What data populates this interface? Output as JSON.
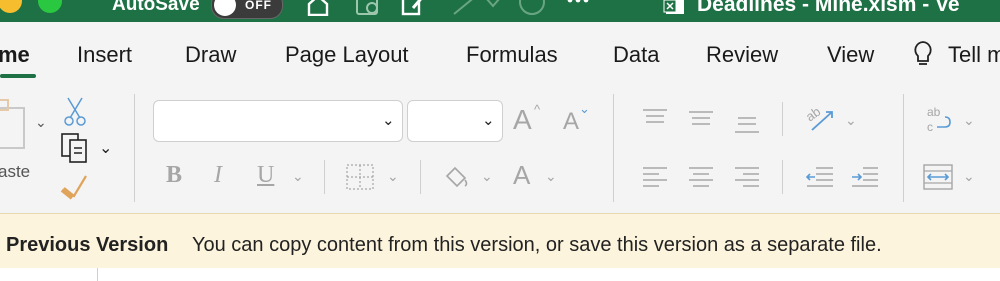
{
  "titlebar": {
    "autosave_label": "AutoSave",
    "toggle_label": "OFF",
    "document_title": "Deadlines - Mine.xlsm - Ve"
  },
  "tabs": [
    {
      "label": "me",
      "active": true
    },
    {
      "label": "Insert"
    },
    {
      "label": "Draw"
    },
    {
      "label": "Page Layout"
    },
    {
      "label": "Formulas"
    },
    {
      "label": "Data"
    },
    {
      "label": "Review"
    },
    {
      "label": "View"
    },
    {
      "label": "Tell m"
    }
  ],
  "ribbon": {
    "paste_label": "aste",
    "font_name_value": "",
    "font_size_value": "",
    "bold": "B",
    "italic": "I",
    "underline": "U",
    "font_color_glyph": "A",
    "increase_font_glyph": "A",
    "decrease_font_glyph": "A",
    "wrap_glyph": "ab"
  },
  "messagebar": {
    "title": "Previous Version",
    "text": "You can copy content from this version, or save this version as a separate file."
  },
  "colors": {
    "titlebar": "#1e7145",
    "ribbon_bg": "#f4f4f4",
    "messagebar_bg": "#fcf4dc",
    "accent_blue": "#3b8fd8"
  }
}
